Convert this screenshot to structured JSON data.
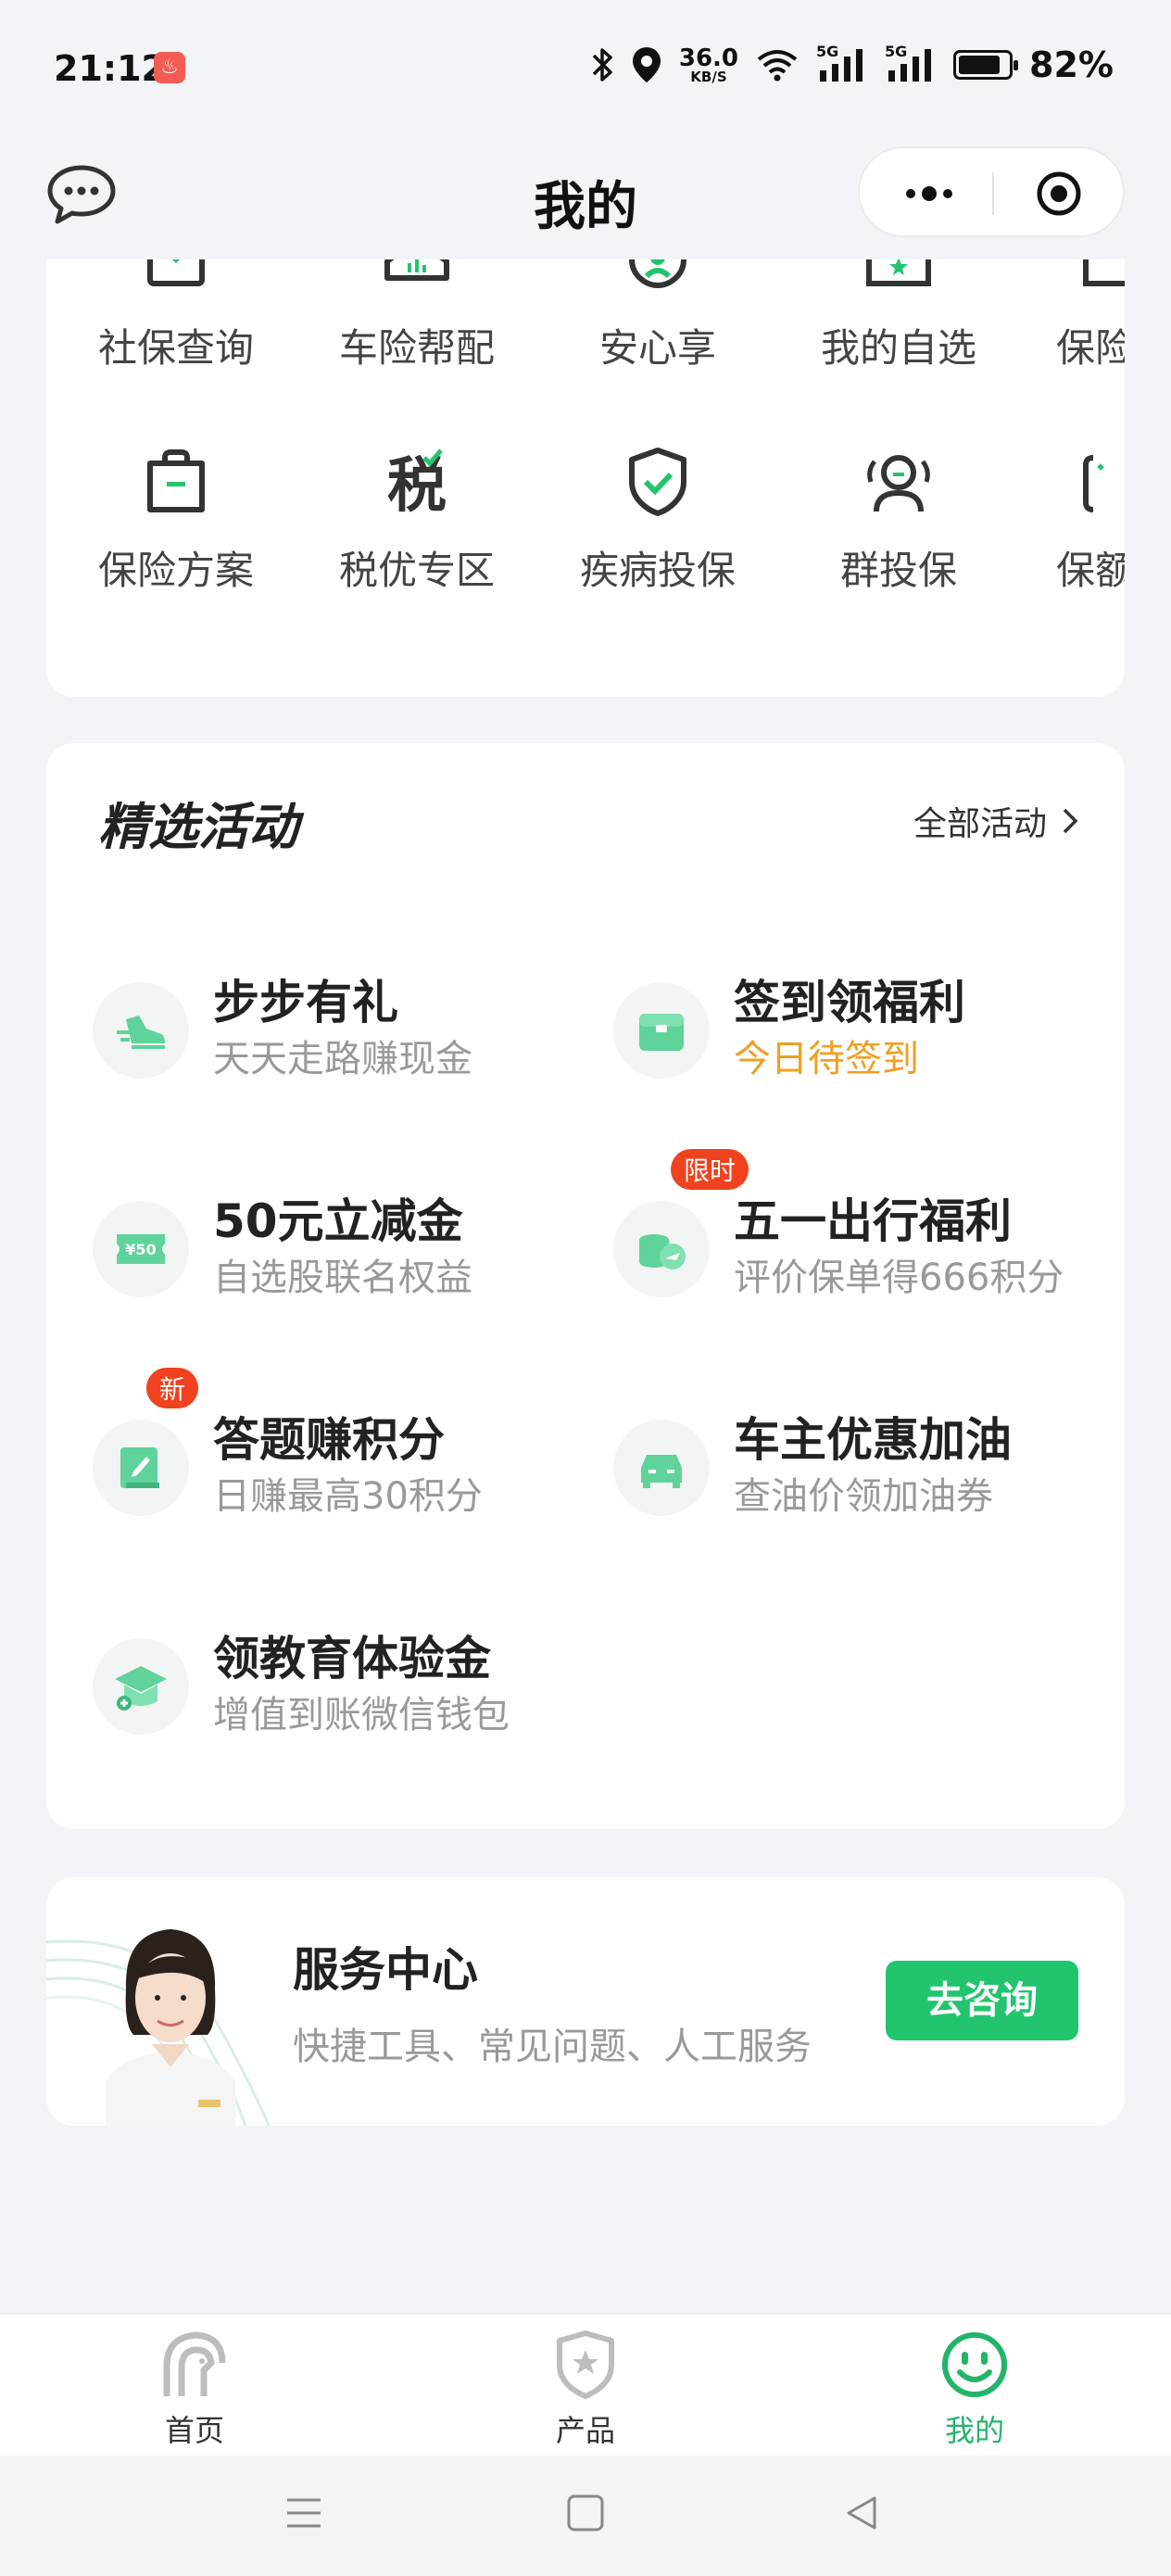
{
  "status_bar": {
    "time": "21:12",
    "speed_value": "36.0",
    "speed_unit": "KB/S",
    "network_1": "5G",
    "network_2": "5G",
    "battery": "82%",
    "battery_level": 0.82
  },
  "nav": {
    "title": "我的"
  },
  "services_grid": {
    "row1": [
      "社保查询",
      "车险帮配",
      "安心享",
      "我的自选",
      "保险"
    ],
    "row2": [
      "保险方案",
      "税优专区",
      "疾病投保",
      "群投保",
      "保额"
    ]
  },
  "activities": {
    "title": "精选活动",
    "all_label": "全部活动",
    "items": [
      {
        "title": "步步有礼",
        "subtitle": "天天走路赚现金"
      },
      {
        "title": "签到领福利",
        "subtitle": "今日待签到"
      },
      {
        "title": "50元立减金",
        "subtitle": "自选股联名权益",
        "icon_text": "¥50"
      },
      {
        "title": "五一出行福利",
        "subtitle": "评价保单得666积分",
        "badge": "限时"
      },
      {
        "title": "答题赚积分",
        "subtitle": "日赚最高30积分",
        "badge": "新"
      },
      {
        "title": "车主优惠加油",
        "subtitle": "查油价领加油券"
      },
      {
        "title": "领教育体验金",
        "subtitle": "增值到账微信钱包"
      }
    ]
  },
  "service_center": {
    "title": "服务中心",
    "subtitle": "快捷工具、常见问题、人工服务",
    "button": "去咨询"
  },
  "tabbar": {
    "tabs": [
      {
        "label": "首页"
      },
      {
        "label": "产品"
      },
      {
        "label": "我的"
      }
    ]
  },
  "colors": {
    "accent": "#22c56e",
    "icon_green": "#5fd39a",
    "orange": "#f0a020",
    "badge_red": "#f0421e",
    "background": "#f2f4f8"
  }
}
